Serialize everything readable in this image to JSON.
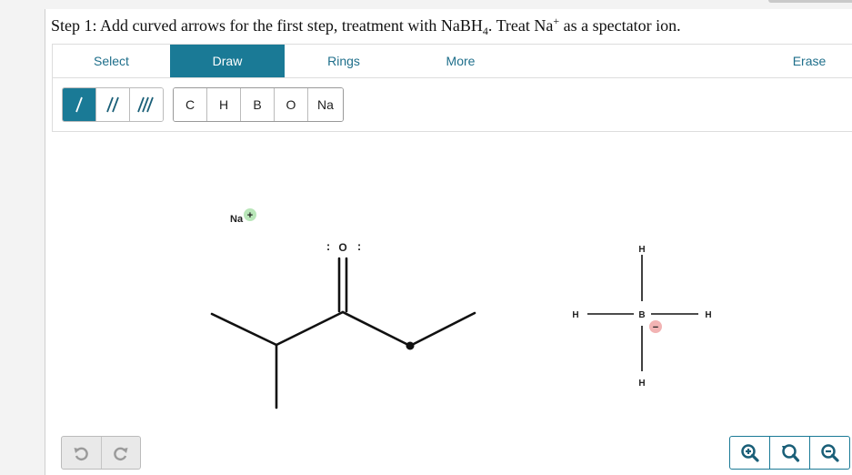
{
  "question": {
    "text_before": "Step 1: Add curved arrows for the first step, treatment with NaBH",
    "reagent_subscript": "4",
    "text_middle": ". Treat Na",
    "cation_superscript": "+",
    "text_after": " as a spectator ion."
  },
  "tabs": [
    "Select",
    "Draw",
    "Rings",
    "More",
    "Erase"
  ],
  "active_tab": "Draw",
  "bond_tools": [
    "single-bond",
    "double-bond",
    "triple-bond"
  ],
  "atom_buttons": [
    "C",
    "H",
    "B",
    "O",
    "Na"
  ],
  "molecule": {
    "sodium_label": "Na",
    "sodium_charge": "+",
    "oxygen_label": "O",
    "oxygen_lone_pairs": ":",
    "borohydride_atoms": {
      "top": "H",
      "left": "H",
      "center": "B",
      "right": "H",
      "bottom": "H"
    },
    "boron_charge": "−"
  },
  "colors": {
    "accent": "#1a7a96",
    "positive_charge_bg": "#b9e6b9",
    "negative_charge_bg": "#f2b3b3"
  },
  "icons": {
    "undo": "undo-icon",
    "redo": "redo-icon",
    "zoom_in": "zoom-in-icon",
    "zoom_reset": "zoom-reset-icon",
    "zoom_out": "zoom-out-icon"
  }
}
